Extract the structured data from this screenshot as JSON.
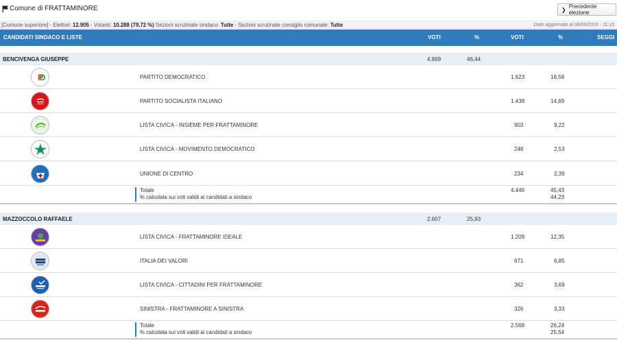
{
  "header": {
    "comune": "Comune di FRATTAMINORE",
    "prev_button": "Precedente elezione"
  },
  "info": {
    "prefix": "[Comune superiore] - Elettori: ",
    "elettori": "12.905",
    "votanti_label": " - Votanti: ",
    "votanti": "10.288",
    "votanti_pct": "(79,72 %)",
    "sez_sindaco_label": " Sezioni scrutinate sindaco: ",
    "sez_sindaco": "Tutte",
    "sez_consiglio_label": " - Sezioni scrutinate consiglio comunale: ",
    "sez_consiglio": "Tutte",
    "updated": "Dato aggiornato al 06/06/2016 - 11:15"
  },
  "table_header": {
    "candidati": "CANDIDATI SINDACO E LISTE",
    "voti1": "VOTI",
    "pct1": "%",
    "voti2": "VOTI",
    "pct2": "%",
    "seggi": "SEGGI"
  },
  "candidates": [
    {
      "name": "BENCIVENGA GIUSEPPE",
      "voti": "4.669",
      "pct": "46,44",
      "lists": [
        {
          "name": "PARTITO DEMOCRATICO",
          "voti": "1.623",
          "pct": "16,58",
          "logo": "pd-logo-icon",
          "logo_text": "PD",
          "color": "#e2231a"
        },
        {
          "name": "PARTITO SOCIALISTA ITALIANO",
          "voti": "1.438",
          "pct": "14,69",
          "logo": "psi-logo-icon",
          "logo_text": "PSI",
          "color": "#d6161a"
        },
        {
          "name": "LISTA CIVICA - INSIEME PER FRATTAMINORE",
          "voti": "903",
          "pct": "9,22",
          "logo": "insieme-logo-icon",
          "logo_text": "Insieme",
          "color": "#49a84a"
        },
        {
          "name": "LISTA CIVICA - MOVIMENTO DEMOCRATICO",
          "voti": "248",
          "pct": "2,53",
          "logo": "star-logo-icon",
          "logo_text": "★",
          "color": "#2eaa4a"
        },
        {
          "name": "UNIONE DI CENTRO",
          "voti": "234",
          "pct": "2,39",
          "logo": "udc-logo-icon",
          "logo_text": "ITALIA",
          "color": "#1e6fb9"
        }
      ],
      "total_label": "Totale",
      "total_note": "% calcolata sui voti validi ai candidati a sindaco",
      "total_voti": "4.446",
      "total_pct": "45,43",
      "total_pct2": "44,23"
    },
    {
      "name": "MAZZOCCOLO RAFFAELE",
      "voti": "2.607",
      "pct": "25,93",
      "lists": [
        {
          "name": "LISTA CIVICA - FRATTAMINORE IDEALE",
          "voti": "1.209",
          "pct": "12,35",
          "logo": "ideale-logo-icon",
          "logo_text": "IDEALE",
          "color": "#6a3f9e"
        },
        {
          "name": "ITALIA DEI VALORI",
          "voti": "671",
          "pct": "6,85",
          "logo": "idv-logo-icon",
          "logo_text": "IDV",
          "color": "#1c3f8c"
        },
        {
          "name": "LISTA CIVICA - CITTADINI PER FRATTAMINORE",
          "voti": "362",
          "pct": "3,69",
          "logo": "cittadini-logo-icon",
          "logo_text": "CITTADINI",
          "color": "#1e5eb5"
        },
        {
          "name": "SINISTRA - FRATTAMINORE A SINISTRA",
          "voti": "326",
          "pct": "3,33",
          "logo": "sinistra-logo-icon",
          "logo_text": "Sinistra",
          "color": "#d7261c"
        }
      ],
      "total_label": "Totale",
      "total_note": "% calcolata sui voti validi ai candidati a sindaco",
      "total_voti": "2.568",
      "total_pct": "26,24",
      "total_pct2": "25,54"
    }
  ]
}
